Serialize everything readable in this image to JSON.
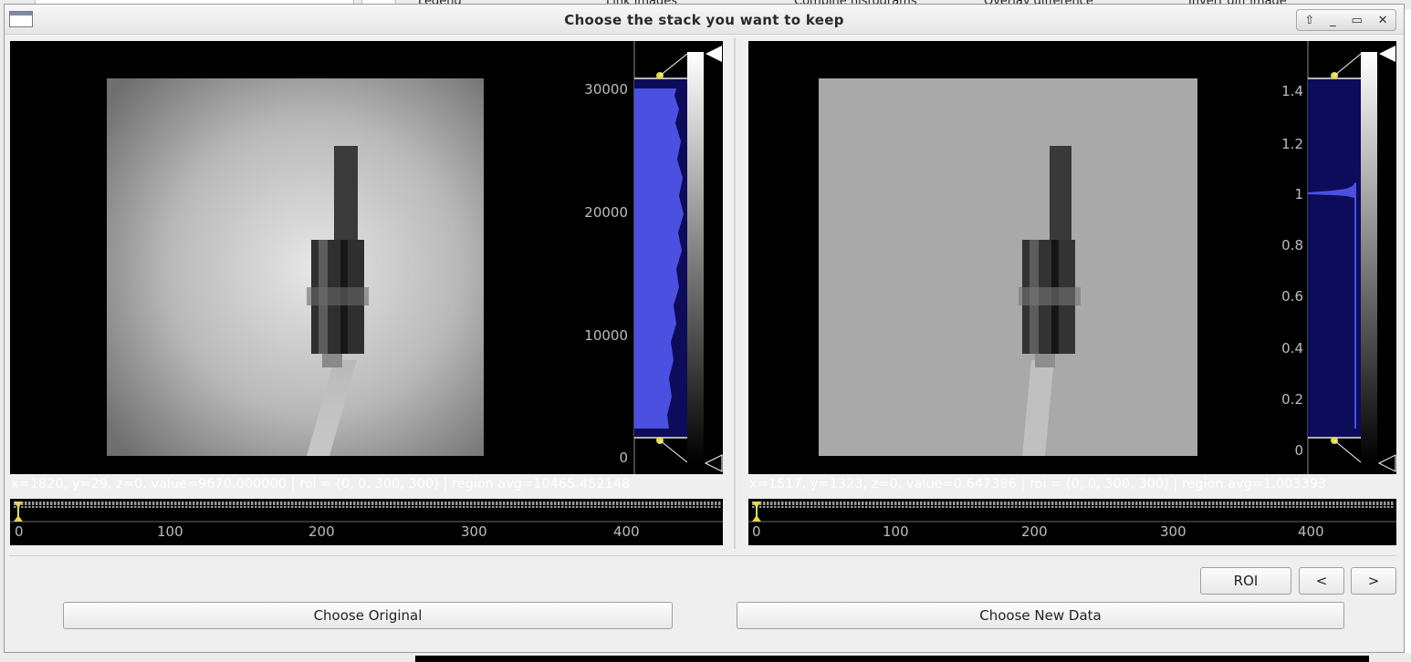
{
  "background": {
    "checks": [
      "Legend",
      "Link images",
      "Combine histograms",
      "Overlay difference",
      "Invert diff image"
    ]
  },
  "dialog": {
    "title": "Choose the stack you want to keep",
    "window_buttons": [
      "⇧",
      "_",
      "▭",
      "✕"
    ]
  },
  "left_panel": {
    "hist_ticks": [
      "30000",
      "20000",
      "10000",
      "0"
    ],
    "status": "x=1820, y=29, z=0, value=9670.000000 | roi = (0, 0, 300, 300) | region avg=10465.452148",
    "timeline_ticks": [
      "0",
      "100",
      "200",
      "300",
      "400"
    ],
    "histogram_color": "#4b50e0"
  },
  "right_panel": {
    "hist_ticks": [
      "1.4",
      "1.2",
      "1",
      "0.8",
      "0.6",
      "0.4",
      "0.2",
      "0"
    ],
    "status": "x=1517, y=1323, z=0, value=0.647386 | roi = (0, 0, 300, 300) | region avg=1.003393",
    "timeline_ticks": [
      "0",
      "100",
      "200",
      "300",
      "400"
    ],
    "histogram_color": "#4b50e0"
  },
  "buttons": {
    "roi": "ROI",
    "prev": "<",
    "next": ">",
    "choose_original": "Choose Original",
    "choose_new": "Choose New Data"
  }
}
